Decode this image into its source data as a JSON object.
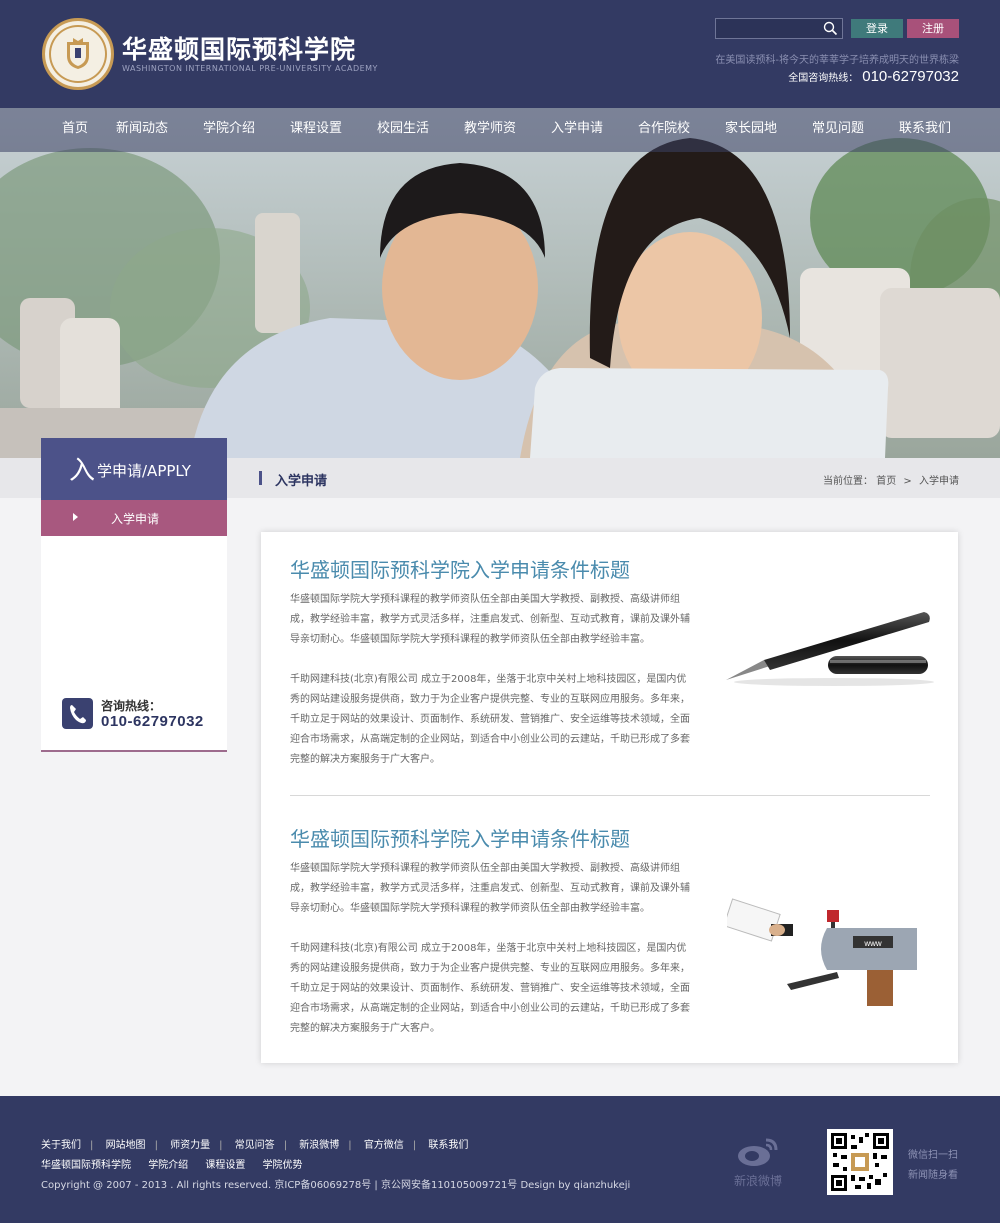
{
  "header": {
    "school_name": "华盛顿国际预科学院",
    "school_name_en": "WASHINGTON INTERNATIONAL PRE-UNIVERSITY ACADEMY",
    "login_label": "登录",
    "register_label": "注册",
    "slogan": "在美国读预科-将今天的莘莘学子培养成明天的世界栋梁",
    "hotline_label": "全国咨询热线：",
    "hotline_number": "010-62797032"
  },
  "nav": {
    "items": [
      {
        "label": "首页"
      },
      {
        "label": "新闻动态"
      },
      {
        "label": "学院介绍"
      },
      {
        "label": "课程设置"
      },
      {
        "label": "校园生活"
      },
      {
        "label": "教学师资"
      },
      {
        "label": "入学申请"
      },
      {
        "label": "合作院校"
      },
      {
        "label": "家长园地"
      },
      {
        "label": "常见问题"
      },
      {
        "label": "联系我们"
      }
    ]
  },
  "sidebar": {
    "heading_big": "入",
    "heading_rest": "学申请/APPLY",
    "item_label": "入学申请",
    "consult_label": "咨询热线：",
    "consult_number": "010-62797032"
  },
  "breadcrumb": {
    "title": "入学申请",
    "prefix": "当前位置：",
    "home": "首页",
    "sep": ">",
    "current": "入学申请"
  },
  "articles": [
    {
      "title": "华盛顿国际预科学院入学申请条件标题",
      "p1": "华盛顿国际学院大学预科课程的教学师资队伍全部由美国大学教授、副教授、高级讲师组成，教学经验丰富，教学方式灵活多样，注重启发式、创新型、互动式教育，课前及课外辅导亲切耐心。华盛顿国际学院大学预科课程的教学师资队伍全部由教学经验丰富。",
      "p2": "千助网建科技(北京)有限公司 成立于2008年，坐落于北京中关村上地科技园区，是国内优秀的网站建设服务提供商，致力于为企业客户提供完整、专业的互联网应用服务。多年来，千助立足于网站的效果设计、页面制作、系统研发、营销推广、安全运维等技术领域，全面迎合市场需求，从高端定制的企业网站，到适合中小创业公司的云建站，千助已形成了多套完整的解决方案服务于广大客户。"
    },
    {
      "title": "华盛顿国际预科学院入学申请条件标题",
      "p1": "华盛顿国际学院大学预科课程的教学师资队伍全部由美国大学教授、副教授、高级讲师组成，教学经验丰富，教学方式灵活多样，注重启发式、创新型、互动式教育，课前及课外辅导亲切耐心。华盛顿国际学院大学预科课程的教学师资队伍全部由教学经验丰富。",
      "p2": "千助网建科技(北京)有限公司 成立于2008年，坐落于北京中关村上地科技园区，是国内优秀的网站建设服务提供商，致力于为企业客户提供完整、专业的互联网应用服务。多年来，千助立足于网站的效果设计、页面制作、系统研发、营销推广、安全运维等技术领域，全面迎合市场需求，从高端定制的企业网站，到适合中小创业公司的云建站，千助已形成了多套完整的解决方案服务于广大客户。"
    }
  ],
  "footer": {
    "links": [
      "关于我们",
      "网站地图",
      "师资力量",
      "常见问答",
      "新浪微博",
      "官方微信",
      "联系我们"
    ],
    "links2": [
      "华盛顿国际预科学院",
      "学院介绍",
      "课程设置",
      "学院优势"
    ],
    "copyright": "Copyright @ 2007 - 2013   . All rights reserved.    京ICP备06069278号 | 京公网安备1101050097​21号  Design by qianzhukeji",
    "weibo_label": "新浪微博",
    "qr_text1": "微信扫一扫",
    "qr_text2": "新闻随身看"
  },
  "icons": {
    "logo": "school-crest-icon",
    "search": "search-icon",
    "phone": "phone-icon",
    "weibo": "weibo-icon",
    "qr": "qr-code"
  },
  "colors": {
    "header_bg": "#333a63",
    "accent_purple": "#4c5289",
    "accent_pink": "#a8587f",
    "title_blue": "#4a8bad",
    "login_green": "#3f7a7b"
  }
}
